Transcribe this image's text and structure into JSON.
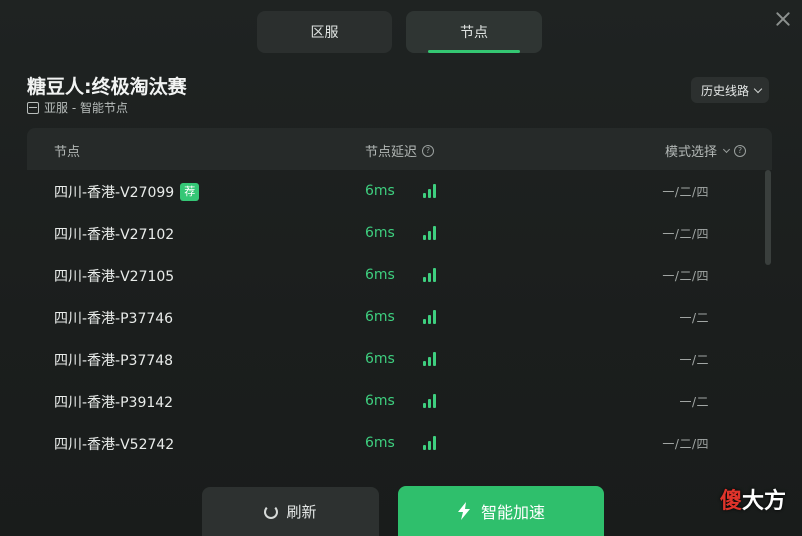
{
  "tabs": [
    {
      "label": "区服",
      "active": false
    },
    {
      "label": "节点",
      "active": true
    }
  ],
  "game": {
    "title": "糖豆人:终极淘汰赛",
    "subtitle": "亚服 - 智能节点"
  },
  "history_label": "历史线路",
  "table": {
    "headers": {
      "node": "节点",
      "delay": "节点延迟",
      "mode": "模式选择"
    },
    "rows": [
      {
        "name": "四川-香港-V27099",
        "tag": "荐",
        "latency": "6ms",
        "mode": "一/二/四"
      },
      {
        "name": "四川-香港-V27102",
        "tag": "",
        "latency": "6ms",
        "mode": "一/二/四"
      },
      {
        "name": "四川-香港-V27105",
        "tag": "",
        "latency": "6ms",
        "mode": "一/二/四"
      },
      {
        "name": "四川-香港-P37746",
        "tag": "",
        "latency": "6ms",
        "mode": "一/二"
      },
      {
        "name": "四川-香港-P37748",
        "tag": "",
        "latency": "6ms",
        "mode": "一/二"
      },
      {
        "name": "四川-香港-P39142",
        "tag": "",
        "latency": "6ms",
        "mode": "一/二"
      },
      {
        "name": "四川-香港-V52742",
        "tag": "",
        "latency": "6ms",
        "mode": "一/二/四"
      }
    ]
  },
  "buttons": {
    "refresh": "刷新",
    "accelerate": "智能加速"
  },
  "watermark": {
    "first": "傻",
    "rest": "大方"
  },
  "colors": {
    "accent": "#2fbf6c",
    "latency": "#3ecf7f",
    "background": "#1c1f1e"
  },
  "icons": [
    "close-icon",
    "server-icon",
    "chevron-down-icon",
    "help-icon",
    "signal-icon",
    "refresh-icon",
    "bolt-icon"
  ]
}
